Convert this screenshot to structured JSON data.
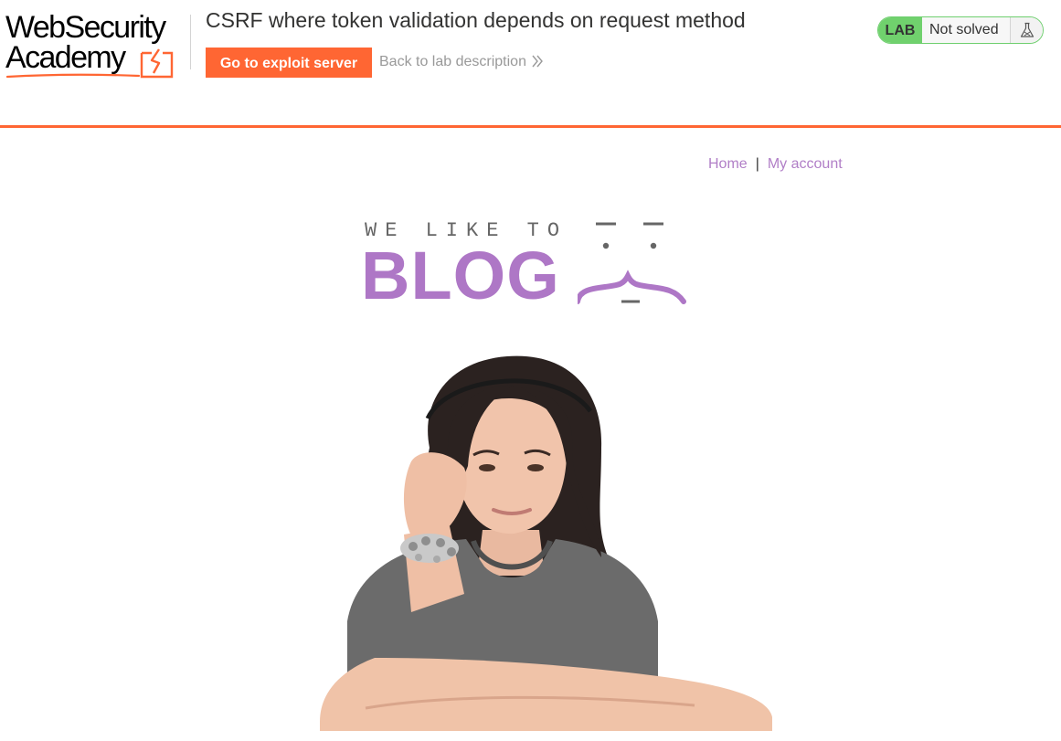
{
  "academy": {
    "logo_line1": "WebSecurity",
    "logo_line2": "Academy",
    "lab_title": "CSRF where token validation depends on request method",
    "exploit_button": "Go to exploit server",
    "back_link": "Back to lab description",
    "lab_badge": "LAB",
    "status": "Not solved"
  },
  "blog": {
    "nav": {
      "home": "Home",
      "separator": "|",
      "my_account": "My account"
    },
    "banner_tagline": "WE LIKE TO",
    "banner_word": "BLOG"
  },
  "colors": {
    "accent_orange": "#ff6633",
    "blog_purple": "#ae77c6",
    "lab_green": "#70d16d"
  }
}
